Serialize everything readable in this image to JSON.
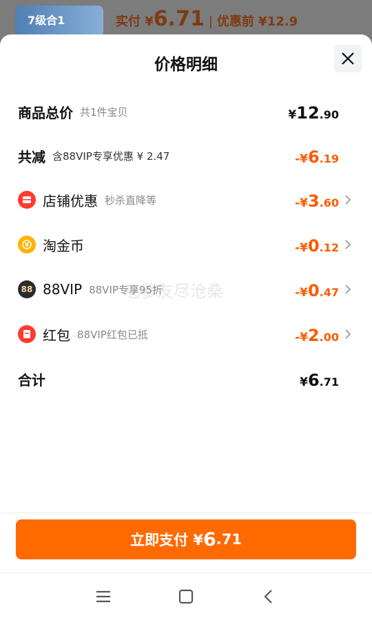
{
  "background": {
    "product_tag": "7级合1",
    "pay_prefix": "实付 ¥",
    "pay_amount": "6.71",
    "pay_separator": "|",
    "pay_before": "优惠前 ¥12.9"
  },
  "sheet": {
    "title": "价格明细",
    "close_icon": "close-icon",
    "watermark": "老爹友尽沧桑"
  },
  "rows": {
    "total": {
      "label": "商品总价",
      "sub": "共1件宝贝",
      "prefix": "¥",
      "int": "12",
      "dec": ".90"
    },
    "reduce": {
      "label": "共减",
      "sub": "含88VIP专享优惠 ¥ 2.47",
      "prefix": "-¥",
      "int": "6",
      "dec": ".19"
    },
    "shop": {
      "label": "店铺优惠",
      "sub": "秒杀直降等",
      "prefix": "-¥",
      "int": "3",
      "dec": ".60",
      "icon": "shop-coupon-icon"
    },
    "coin": {
      "label": "淘金币",
      "sub": "",
      "prefix": "-¥",
      "int": "0",
      "dec": ".12",
      "icon": "gold-coin-icon"
    },
    "vip": {
      "label": "88VIP",
      "sub": "88VIP专享95折",
      "prefix": "-¥",
      "int": "0",
      "dec": ".47",
      "icon": "vip-88-icon",
      "icon_text": "88"
    },
    "redpacket": {
      "label": "红包",
      "sub": "88VIP红包已抵",
      "prefix": "-¥",
      "int": "2",
      "dec": ".00",
      "icon": "red-packet-icon"
    },
    "sum": {
      "label": "合计",
      "prefix": "¥",
      "int": "6",
      "dec": ".71"
    }
  },
  "pay_button": {
    "label": "立即支付 ¥",
    "int": "6",
    "dec": ".71"
  },
  "navbar": {
    "menu_icon": "menu-icon",
    "home_icon": "home-icon",
    "back_icon": "back-icon"
  },
  "colors": {
    "accent": "#ff6a00",
    "discount_text": "#ff5a00",
    "shop_icon": "#ff3b30",
    "coin_icon": "#ffb300",
    "vip_icon": "#2b2b2b"
  }
}
